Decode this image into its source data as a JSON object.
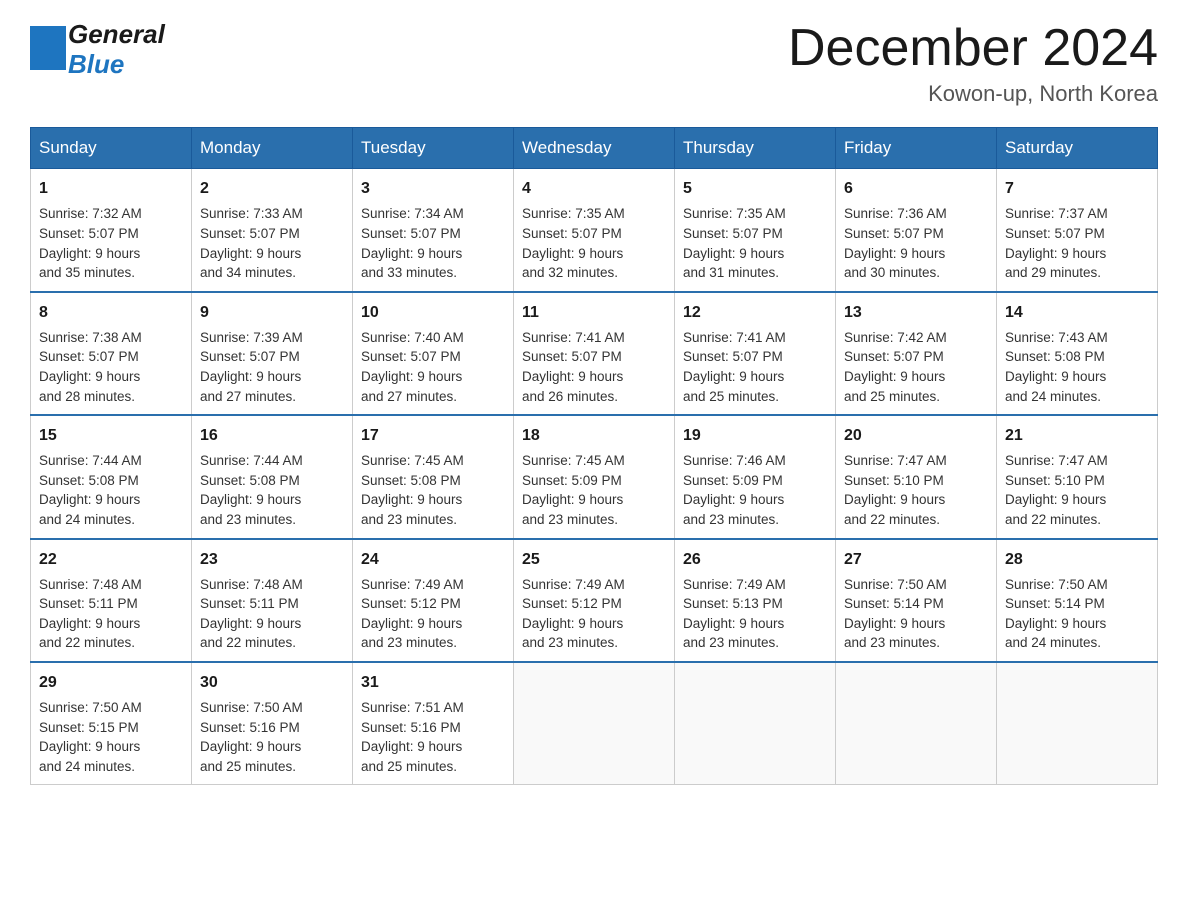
{
  "header": {
    "logo_line1": "General",
    "logo_line2": "Blue",
    "title": "December 2024",
    "location": "Kowon-up, North Korea"
  },
  "days_of_week": [
    "Sunday",
    "Monday",
    "Tuesday",
    "Wednesday",
    "Thursday",
    "Friday",
    "Saturday"
  ],
  "weeks": [
    [
      {
        "day": "1",
        "sunrise": "7:32 AM",
        "sunset": "5:07 PM",
        "daylight": "9 hours and 35 minutes."
      },
      {
        "day": "2",
        "sunrise": "7:33 AM",
        "sunset": "5:07 PM",
        "daylight": "9 hours and 34 minutes."
      },
      {
        "day": "3",
        "sunrise": "7:34 AM",
        "sunset": "5:07 PM",
        "daylight": "9 hours and 33 minutes."
      },
      {
        "day": "4",
        "sunrise": "7:35 AM",
        "sunset": "5:07 PM",
        "daylight": "9 hours and 32 minutes."
      },
      {
        "day": "5",
        "sunrise": "7:35 AM",
        "sunset": "5:07 PM",
        "daylight": "9 hours and 31 minutes."
      },
      {
        "day": "6",
        "sunrise": "7:36 AM",
        "sunset": "5:07 PM",
        "daylight": "9 hours and 30 minutes."
      },
      {
        "day": "7",
        "sunrise": "7:37 AM",
        "sunset": "5:07 PM",
        "daylight": "9 hours and 29 minutes."
      }
    ],
    [
      {
        "day": "8",
        "sunrise": "7:38 AM",
        "sunset": "5:07 PM",
        "daylight": "9 hours and 28 minutes."
      },
      {
        "day": "9",
        "sunrise": "7:39 AM",
        "sunset": "5:07 PM",
        "daylight": "9 hours and 27 minutes."
      },
      {
        "day": "10",
        "sunrise": "7:40 AM",
        "sunset": "5:07 PM",
        "daylight": "9 hours and 27 minutes."
      },
      {
        "day": "11",
        "sunrise": "7:41 AM",
        "sunset": "5:07 PM",
        "daylight": "9 hours and 26 minutes."
      },
      {
        "day": "12",
        "sunrise": "7:41 AM",
        "sunset": "5:07 PM",
        "daylight": "9 hours and 25 minutes."
      },
      {
        "day": "13",
        "sunrise": "7:42 AM",
        "sunset": "5:07 PM",
        "daylight": "9 hours and 25 minutes."
      },
      {
        "day": "14",
        "sunrise": "7:43 AM",
        "sunset": "5:08 PM",
        "daylight": "9 hours and 24 minutes."
      }
    ],
    [
      {
        "day": "15",
        "sunrise": "7:44 AM",
        "sunset": "5:08 PM",
        "daylight": "9 hours and 24 minutes."
      },
      {
        "day": "16",
        "sunrise": "7:44 AM",
        "sunset": "5:08 PM",
        "daylight": "9 hours and 23 minutes."
      },
      {
        "day": "17",
        "sunrise": "7:45 AM",
        "sunset": "5:08 PM",
        "daylight": "9 hours and 23 minutes."
      },
      {
        "day": "18",
        "sunrise": "7:45 AM",
        "sunset": "5:09 PM",
        "daylight": "9 hours and 23 minutes."
      },
      {
        "day": "19",
        "sunrise": "7:46 AM",
        "sunset": "5:09 PM",
        "daylight": "9 hours and 23 minutes."
      },
      {
        "day": "20",
        "sunrise": "7:47 AM",
        "sunset": "5:10 PM",
        "daylight": "9 hours and 22 minutes."
      },
      {
        "day": "21",
        "sunrise": "7:47 AM",
        "sunset": "5:10 PM",
        "daylight": "9 hours and 22 minutes."
      }
    ],
    [
      {
        "day": "22",
        "sunrise": "7:48 AM",
        "sunset": "5:11 PM",
        "daylight": "9 hours and 22 minutes."
      },
      {
        "day": "23",
        "sunrise": "7:48 AM",
        "sunset": "5:11 PM",
        "daylight": "9 hours and 22 minutes."
      },
      {
        "day": "24",
        "sunrise": "7:49 AM",
        "sunset": "5:12 PM",
        "daylight": "9 hours and 23 minutes."
      },
      {
        "day": "25",
        "sunrise": "7:49 AM",
        "sunset": "5:12 PM",
        "daylight": "9 hours and 23 minutes."
      },
      {
        "day": "26",
        "sunrise": "7:49 AM",
        "sunset": "5:13 PM",
        "daylight": "9 hours and 23 minutes."
      },
      {
        "day": "27",
        "sunrise": "7:50 AM",
        "sunset": "5:14 PM",
        "daylight": "9 hours and 23 minutes."
      },
      {
        "day": "28",
        "sunrise": "7:50 AM",
        "sunset": "5:14 PM",
        "daylight": "9 hours and 24 minutes."
      }
    ],
    [
      {
        "day": "29",
        "sunrise": "7:50 AM",
        "sunset": "5:15 PM",
        "daylight": "9 hours and 24 minutes."
      },
      {
        "day": "30",
        "sunrise": "7:50 AM",
        "sunset": "5:16 PM",
        "daylight": "9 hours and 25 minutes."
      },
      {
        "day": "31",
        "sunrise": "7:51 AM",
        "sunset": "5:16 PM",
        "daylight": "9 hours and 25 minutes."
      },
      null,
      null,
      null,
      null
    ]
  ],
  "labels": {
    "sunrise": "Sunrise: ",
    "sunset": "Sunset: ",
    "daylight": "Daylight: "
  }
}
